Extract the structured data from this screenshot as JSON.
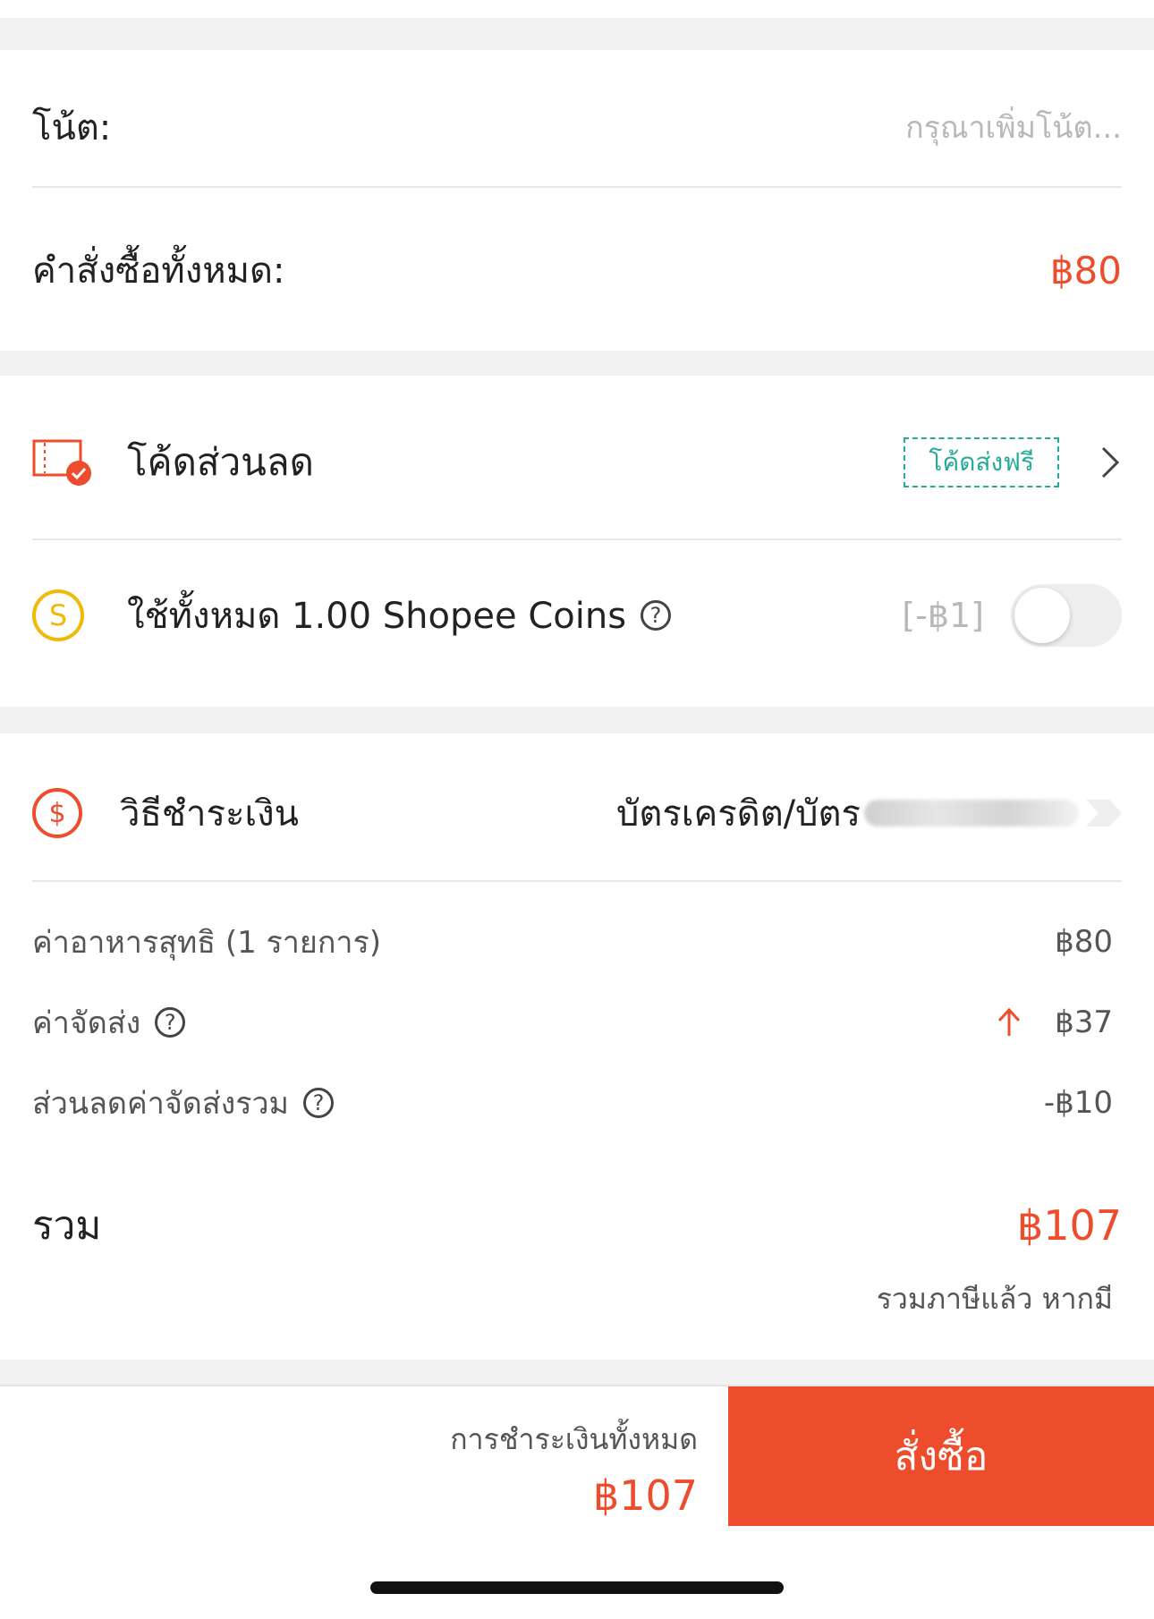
{
  "note": {
    "label": "โน้ต:",
    "placeholder": "กรุณาเพิ่มโน้ต..."
  },
  "order_total": {
    "label": "คำสั่งซื้อทั้งหมด:",
    "value": "฿80"
  },
  "voucher": {
    "label": "โค้ดส่วนลด",
    "tag": "โค้ดส่งฟรี",
    "icon": "voucher-icon"
  },
  "coins": {
    "label": "ใช้ทั้งหมด 1.00 Shopee Coins",
    "amount": "[-฿1]",
    "toggle_on": false
  },
  "payment": {
    "label": "วิธีชำระเงิน",
    "value": "บัตรเครดิต/บัตร",
    "icon": "dollar-circle-icon"
  },
  "summary": {
    "rows": [
      {
        "label": "ค่าอาหารสุทธิ (1 รายการ)",
        "value": "฿80"
      },
      {
        "label": "ค่าจัดส่ง",
        "value": "฿37"
      },
      {
        "label": "ส่วนลดค่าจัดส่งรวม",
        "value": "-฿10"
      }
    ],
    "total_label": "รวม",
    "total_value": "฿107",
    "tax_note": "รวมภาษีแล้ว หากมี"
  },
  "footer": {
    "pay_label": "การชำระเงินทั้งหมด",
    "pay_value": "฿107",
    "order_button": "สั่งซื้อ"
  },
  "colors": {
    "accent": "#ee4d2d",
    "coin": "#f0b90b",
    "teal": "#26aa99"
  }
}
